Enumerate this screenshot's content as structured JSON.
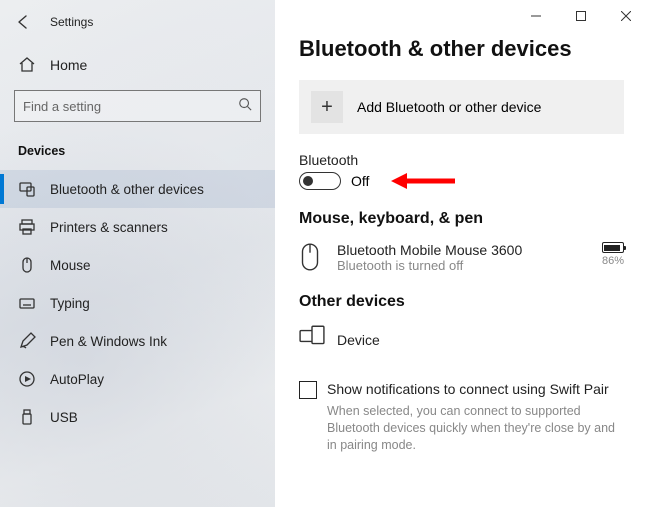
{
  "window": {
    "title": "Settings"
  },
  "sidebar": {
    "home_label": "Home",
    "search_placeholder": "Find a setting",
    "category": "Devices",
    "items": [
      {
        "label": "Bluetooth & other devices",
        "active": true
      },
      {
        "label": "Printers & scanners"
      },
      {
        "label": "Mouse"
      },
      {
        "label": "Typing"
      },
      {
        "label": "Pen & Windows Ink"
      },
      {
        "label": "AutoPlay"
      },
      {
        "label": "USB"
      }
    ]
  },
  "main": {
    "heading": "Bluetooth & other devices",
    "add_device_label": "Add Bluetooth or other device",
    "bluetooth": {
      "label": "Bluetooth",
      "state_text": "Off"
    },
    "sections": {
      "mouse_kbd_pen": {
        "heading": "Mouse, keyboard, & pen",
        "device": {
          "name": "Bluetooth Mobile Mouse 3600",
          "status": "Bluetooth is turned off",
          "battery_pct": "86%"
        }
      },
      "other_devices": {
        "heading": "Other devices",
        "device_name": "Device"
      }
    },
    "swift_pair": {
      "label": "Show notifications to connect using Swift Pair",
      "description": "When selected, you can connect to supported Bluetooth devices quickly when they're close by and in pairing mode."
    }
  }
}
